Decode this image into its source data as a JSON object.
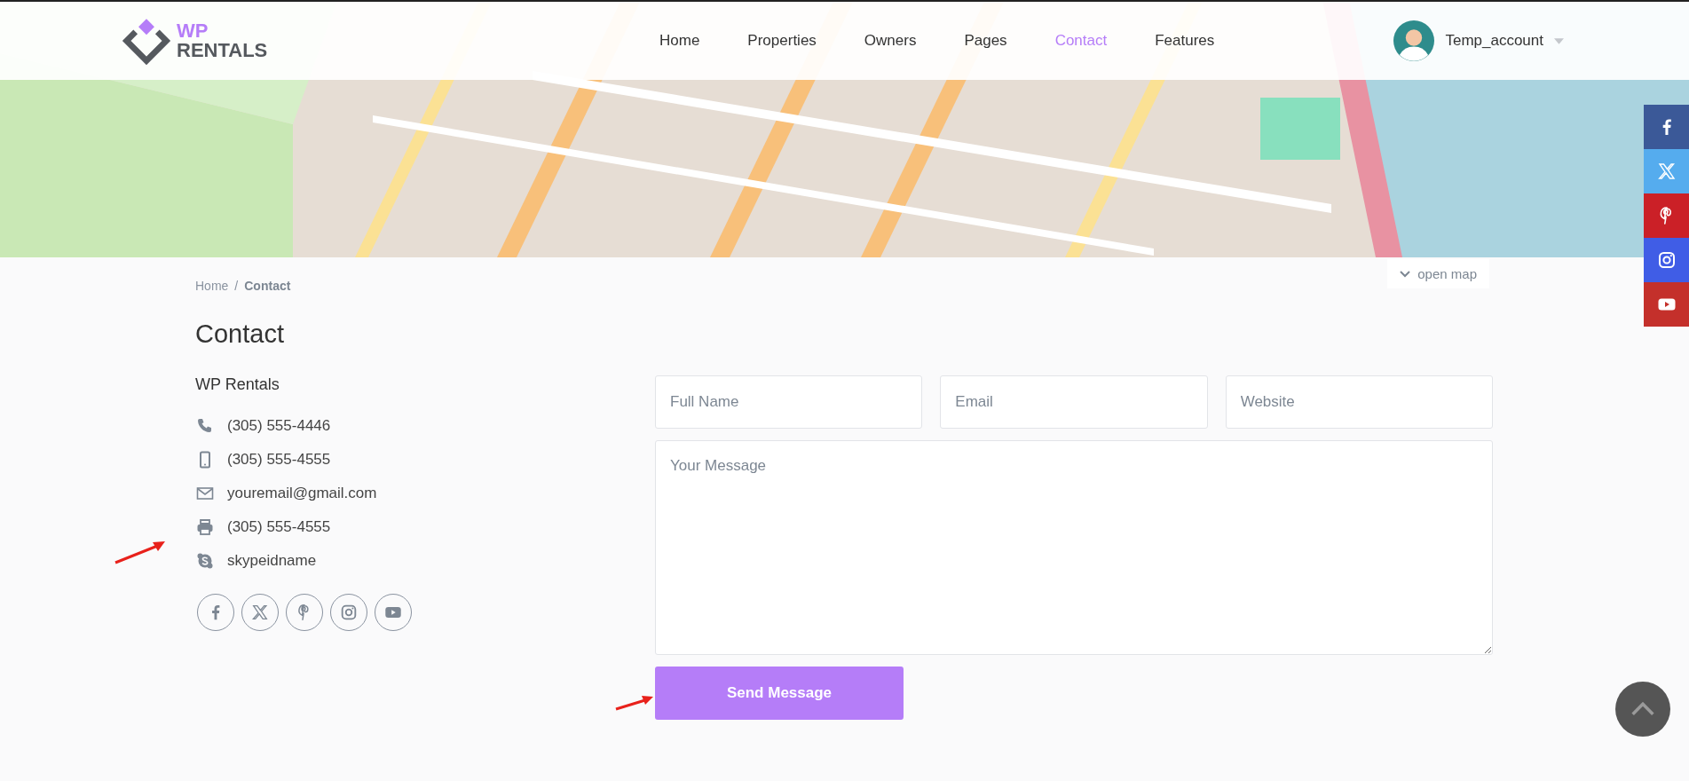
{
  "logo": {
    "line_1": "WP",
    "line_2": "RENTALS"
  },
  "nav": [
    {
      "label": "Home",
      "selected": false
    },
    {
      "label": "Properties",
      "selected": false
    },
    {
      "label": "Owners",
      "selected": false
    },
    {
      "label": "Pages",
      "selected": false
    },
    {
      "label": "Contact",
      "selected": true
    },
    {
      "label": "Features",
      "selected": false
    }
  ],
  "account": {
    "name": "Temp_account"
  },
  "map": {
    "kind": "picture",
    "toggle": "open map"
  },
  "breadcrumb": [
    {
      "label": "Home",
      "selected": false
    },
    {
      "label": "Contact",
      "selected": true
    }
  ],
  "breadcrumb_separator": "/",
  "page_title": "Contact",
  "company": "WP Rentals",
  "contacts": [
    {
      "kind": "phone",
      "text": "(305) 555-4446"
    },
    {
      "kind": "mobile",
      "text": "(305) 555-4555"
    },
    {
      "kind": "email",
      "text": "youremail@gmail.com"
    },
    {
      "kind": "fax",
      "text": "(305) 555-4555"
    },
    {
      "kind": "skype",
      "text": "skypeidname"
    }
  ],
  "socials": [
    {
      "kind": "facebook"
    },
    {
      "kind": "x"
    },
    {
      "kind": "pinterest"
    },
    {
      "kind": "instagram"
    },
    {
      "kind": "youtube"
    }
  ],
  "form": {
    "fields": [
      {
        "placeholder": "Full Name"
      },
      {
        "placeholder": "Email"
      },
      {
        "placeholder": "Website"
      }
    ],
    "message": {
      "placeholder": "Your Message"
    },
    "submit": "Send Message"
  },
  "side_share": [
    {
      "kind": "facebook",
      "color": "#3b5998"
    },
    {
      "kind": "x",
      "color": "#55acee"
    },
    {
      "kind": "pinterest",
      "color": "#cb2027"
    },
    {
      "kind": "instagram",
      "color": "#405de6"
    },
    {
      "kind": "youtube",
      "color": "#c4302b"
    }
  ]
}
